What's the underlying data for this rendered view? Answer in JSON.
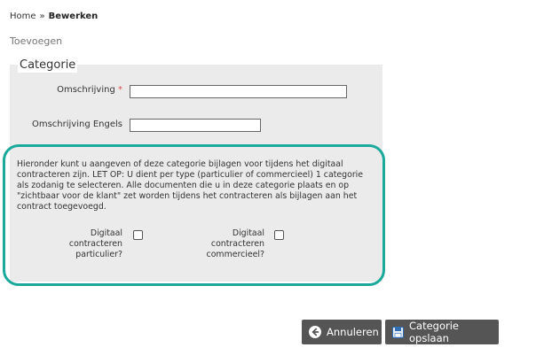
{
  "breadcrumb": {
    "home": "Home",
    "separator": "»",
    "current": "Bewerken"
  },
  "page": {
    "subtitle": "Toevoegen"
  },
  "form": {
    "legend": "Categorie",
    "omschrijving_label": "Omschrijving",
    "required_mark": "*",
    "omschrijving_value": "",
    "omschrijving_engels_label": "Omschrijving Engels",
    "omschrijving_engels_value": ""
  },
  "info": {
    "text": "Hieronder kunt u aangeven of deze categorie bijlagen voor tijdens het digitaal contracteren zijn. LET OP: U dient per type (particulier of commercieel) 1 categorie als zodanig te selecteren. Alle documenten die u in deze categorie plaats en op \"zichtbaar voor de klant\" zet worden tijdens het contracteren als bijlagen aan het contract toegevoegd."
  },
  "checkboxes": {
    "particulier": {
      "line1": "Digitaal",
      "line2": "contracteren",
      "line3": "particulier?",
      "checked": false
    },
    "commercieel": {
      "line1": "Digitaal",
      "line2": "contracteren",
      "line3": "commercieel?",
      "checked": false
    }
  },
  "buttons": {
    "cancel_label": "Annuleren",
    "cancel_icon": "arrow-left-circle-icon",
    "save_label": "Categorie opslaan",
    "save_icon": "floppy-disk-icon"
  },
  "colors": {
    "highlight": "#1aa99a",
    "button": "#555555",
    "panel": "#ebebeb",
    "required": "#d9534f"
  }
}
